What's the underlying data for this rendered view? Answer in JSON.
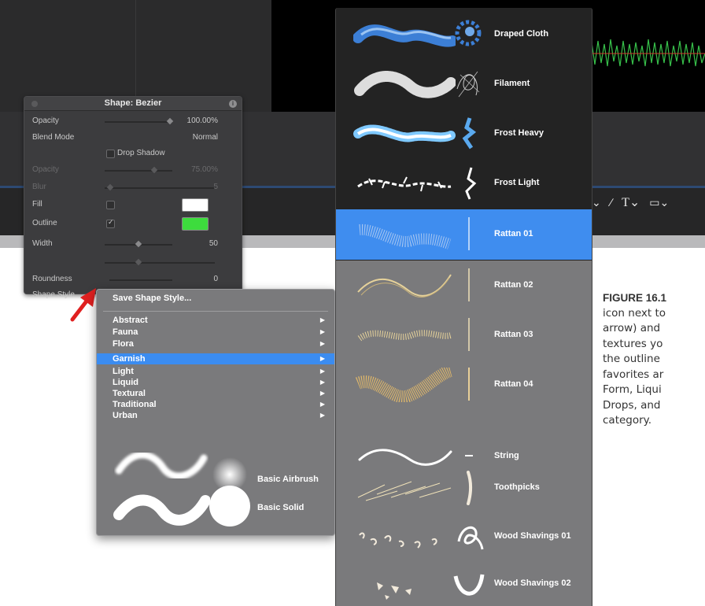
{
  "inspector": {
    "title": "Shape: Bezier",
    "rows": {
      "opacity": {
        "label": "Opacity",
        "value": "100.00%"
      },
      "blend_mode": {
        "label": "Blend Mode",
        "value": "Normal"
      },
      "drop_shadow": {
        "label": "Drop Shadow"
      },
      "shadow_opacity": {
        "label": "Opacity",
        "value": "75.00%"
      },
      "blur": {
        "label": "Blur",
        "value": "5"
      },
      "fill": {
        "label": "Fill"
      },
      "outline": {
        "label": "Outline"
      },
      "width": {
        "label": "Width",
        "value": "50"
      },
      "roundness": {
        "label": "Roundness",
        "value": "0"
      },
      "shape_style": {
        "label": "Shape Style"
      }
    },
    "fill_color": "#ffffff",
    "outline_color": "#3ddc3d"
  },
  "style_menu": {
    "save_label": "Save Shape Style...",
    "categories": [
      "Abstract",
      "Fauna",
      "Flora",
      "Garnish",
      "Light",
      "Liquid",
      "Textural",
      "Traditional",
      "Urban"
    ],
    "selected_category": "Garnish",
    "presets": [
      "Basic Airbrush",
      "Basic Solid"
    ]
  },
  "brushes": [
    {
      "name": "Draped Cloth",
      "color": "#3c7fd6"
    },
    {
      "name": "Filament",
      "color": "#e8e8e8"
    },
    {
      "name": "Frost Heavy",
      "color": "#7fc9ff"
    },
    {
      "name": "Frost Light",
      "color": "#ffffff"
    },
    {
      "name": "Rattan 01",
      "color": "#a9c7f0",
      "selected": true
    },
    {
      "name": "Rattan 02",
      "color": "#e6d29a"
    },
    {
      "name": "Rattan 03",
      "color": "#e6d29a"
    },
    {
      "name": "Rattan 04",
      "color": "#e0b86a"
    },
    {
      "name": "String",
      "color": "#ffffff"
    },
    {
      "name": "Toothpicks",
      "color": "#efe1b8"
    },
    {
      "name": "Wood Shavings 01",
      "color": "#f2eadb"
    },
    {
      "name": "Wood Shavings 02",
      "color": "#f2eadb"
    }
  ],
  "caption": {
    "figure": "FIGURE 16.1",
    "lines": [
      "icon next to",
      "arrow) and",
      "textures yo",
      "the outline",
      "favorites ar",
      "Form, Liqui",
      "Drops, and",
      "category."
    ]
  },
  "colors": {
    "accent": "#3b8cf0",
    "arrow": "#e02020"
  },
  "icons": [
    "close-icon",
    "info-icon",
    "red-arrow-icon",
    "submenu-arrow-icon",
    "pen-icon",
    "text-icon",
    "shape-icon"
  ]
}
